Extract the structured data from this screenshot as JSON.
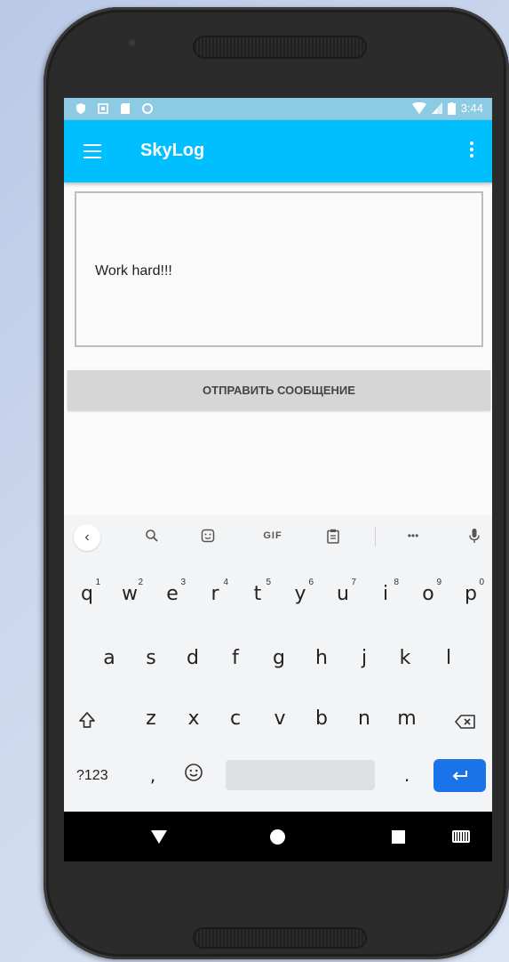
{
  "status_bar": {
    "time": "3:44",
    "icons_left": [
      "shield-icon",
      "sim-icon",
      "sd-card-icon",
      "circle-icon"
    ],
    "icons_right": [
      "wifi-icon",
      "signal-icon",
      "battery-icon"
    ]
  },
  "app_bar": {
    "title": "SkyLog",
    "color": "#00bfff"
  },
  "message_box": {
    "value": "Work hard!!!"
  },
  "send_button": {
    "label": "ОТПРАВИТЬ СООБЩЕНИЕ"
  },
  "keyboard": {
    "toolbar": {
      "gif_label": "GIF",
      "more_label": "•••"
    },
    "row1": [
      {
        "key": "q",
        "num": "1"
      },
      {
        "key": "w",
        "num": "2"
      },
      {
        "key": "e",
        "num": "3"
      },
      {
        "key": "r",
        "num": "4"
      },
      {
        "key": "t",
        "num": "5"
      },
      {
        "key": "y",
        "num": "6"
      },
      {
        "key": "u",
        "num": "7"
      },
      {
        "key": "i",
        "num": "8"
      },
      {
        "key": "o",
        "num": "9"
      },
      {
        "key": "p",
        "num": "0"
      }
    ],
    "row2": [
      "a",
      "s",
      "d",
      "f",
      "g",
      "h",
      "j",
      "k",
      "l"
    ],
    "row3": [
      "z",
      "x",
      "c",
      "v",
      "b",
      "n",
      "m"
    ],
    "symbols_label": "?123",
    "comma": ",",
    "period": ".",
    "enter_color": "#1a73e8"
  }
}
